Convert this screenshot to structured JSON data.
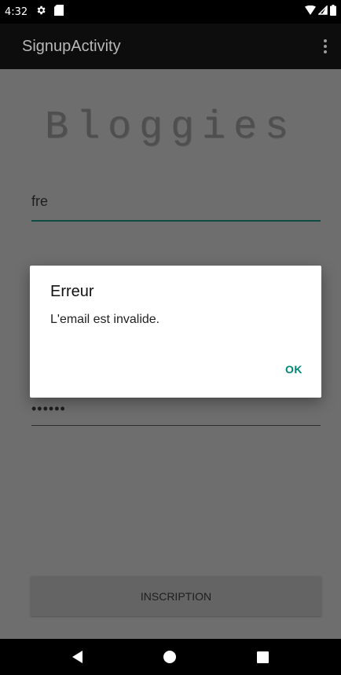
{
  "status_bar": {
    "time": "4:32",
    "icons": [
      "settings-icon",
      "sd-card-icon",
      "wifi-icon",
      "signal-icon",
      "battery-icon"
    ]
  },
  "app_bar": {
    "title": "SignupActivity",
    "overflow_icon": "overflow-menu-icon"
  },
  "form": {
    "logo_text": "Bloggies",
    "username_value": "fre",
    "password_value": "••••••",
    "signup_label": "INSCRIPTION"
  },
  "dialog": {
    "title": "Erreur",
    "message": "L'email est invalide.",
    "ok_label": "OK"
  },
  "nav_bar": {
    "icons": [
      "back-icon",
      "home-icon",
      "recents-icon"
    ]
  },
  "colors": {
    "accent": "#008577",
    "app_bar": "#0d0d0d",
    "scrim_background": "#6e6e6e"
  }
}
